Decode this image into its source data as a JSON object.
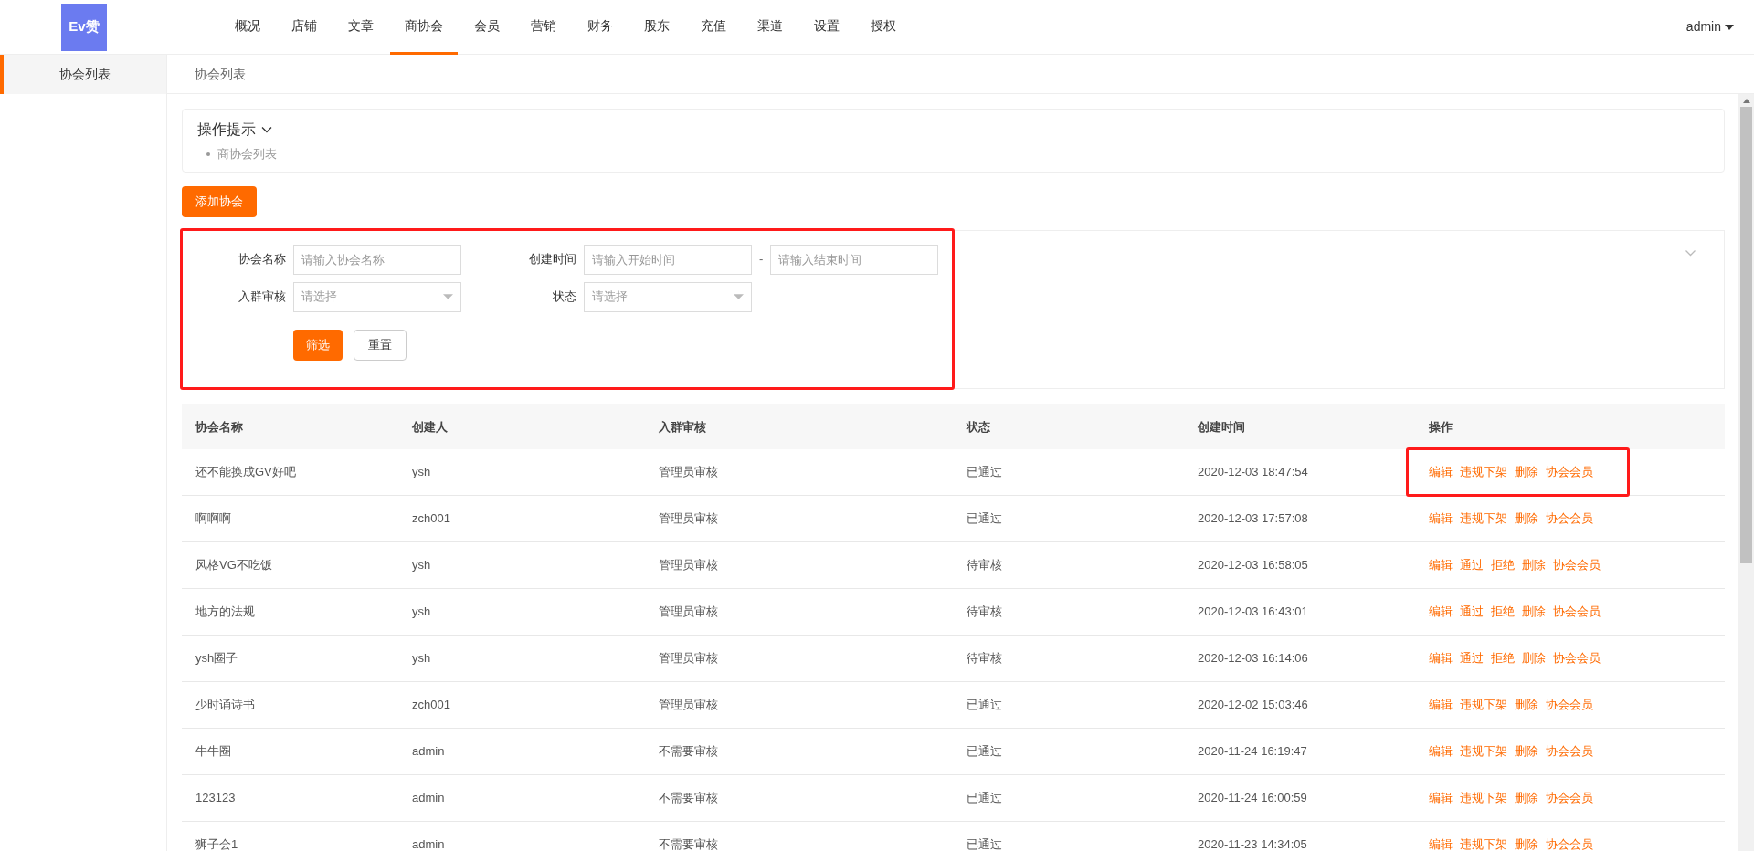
{
  "header": {
    "logo_text": "Ev赞",
    "nav": [
      {
        "label": "概况",
        "selected": false
      },
      {
        "label": "店铺",
        "selected": false
      },
      {
        "label": "文章",
        "selected": false
      },
      {
        "label": "商协会",
        "selected": true
      },
      {
        "label": "会员",
        "selected": false
      },
      {
        "label": "营销",
        "selected": false
      },
      {
        "label": "财务",
        "selected": false
      },
      {
        "label": "股东",
        "selected": false
      },
      {
        "label": "充值",
        "selected": false
      },
      {
        "label": "渠道",
        "selected": false
      },
      {
        "label": "设置",
        "selected": false
      },
      {
        "label": "授权",
        "selected": false
      }
    ],
    "user": "admin"
  },
  "sidebar": {
    "items": [
      {
        "label": "协会列表",
        "selected": true
      }
    ]
  },
  "breadcrumb": "协会列表",
  "tips": {
    "title": "操作提示",
    "items": [
      "商协会列表"
    ]
  },
  "add_button": "添加协会",
  "filter": {
    "highlighted": true,
    "fields": [
      {
        "kind": "text",
        "label": "协会名称",
        "placeholder": "请输入协会名称"
      },
      {
        "kind": "range",
        "label": "创建时间",
        "placeholder": "请输入开始时间",
        "separator": "-",
        "placeholder_end": "请输入结束时间"
      },
      {
        "kind": "select",
        "label": "入群审核",
        "placeholder": "请选择"
      },
      {
        "kind": "select",
        "label": "状态",
        "placeholder": "请选择"
      }
    ],
    "submit": "筛选",
    "reset": "重置"
  },
  "table": {
    "columns": [
      "协会名称",
      "创建人",
      "入群审核",
      "状态",
      "创建时间",
      "操作"
    ],
    "rows": [
      {
        "name": "还不能换成GV好吧",
        "creator": "ysh",
        "review": "管理员审核",
        "status": "已通过",
        "created": "2020-12-03 18:47:54",
        "actions": [
          "编辑",
          "违规下架",
          "删除",
          "协会会员"
        ],
        "actions_highlighted": true
      },
      {
        "name": "啊啊啊",
        "creator": "zch001",
        "review": "管理员审核",
        "status": "已通过",
        "created": "2020-12-03 17:57:08",
        "actions": [
          "编辑",
          "违规下架",
          "删除",
          "协会会员"
        ],
        "actions_highlighted": false
      },
      {
        "name": "风格VG不吃饭",
        "creator": "ysh",
        "review": "管理员审核",
        "status": "待审核",
        "created": "2020-12-03 16:58:05",
        "actions": [
          "编辑",
          "通过",
          "拒绝",
          "删除",
          "协会会员"
        ],
        "actions_highlighted": false
      },
      {
        "name": "地方的法规",
        "creator": "ysh",
        "review": "管理员审核",
        "status": "待审核",
        "created": "2020-12-03 16:43:01",
        "actions": [
          "编辑",
          "通过",
          "拒绝",
          "删除",
          "协会会员"
        ],
        "actions_highlighted": false
      },
      {
        "name": "ysh圈子",
        "creator": "ysh",
        "review": "管理员审核",
        "status": "待审核",
        "created": "2020-12-03 16:14:06",
        "actions": [
          "编辑",
          "通过",
          "拒绝",
          "删除",
          "协会会员"
        ],
        "actions_highlighted": false
      },
      {
        "name": "少时诵诗书",
        "creator": "zch001",
        "review": "管理员审核",
        "status": "已通过",
        "created": "2020-12-02 15:03:46",
        "actions": [
          "编辑",
          "违规下架",
          "删除",
          "协会会员"
        ],
        "actions_highlighted": false
      },
      {
        "name": "牛牛圈",
        "creator": "admin",
        "review": "不需要审核",
        "status": "已通过",
        "created": "2020-11-24 16:19:47",
        "actions": [
          "编辑",
          "违规下架",
          "删除",
          "协会会员"
        ],
        "actions_highlighted": false
      },
      {
        "name": "123123",
        "creator": "admin",
        "review": "不需要审核",
        "status": "已通过",
        "created": "2020-11-24 16:00:59",
        "actions": [
          "编辑",
          "违规下架",
          "删除",
          "协会会员"
        ],
        "actions_highlighted": false
      },
      {
        "name": "狮子会1",
        "creator": "admin",
        "review": "不需要审核",
        "status": "已通过",
        "created": "2020-11-23 14:34:05",
        "actions": [
          "编辑",
          "违规下架",
          "删除",
          "协会会员"
        ],
        "actions_highlighted": false
      }
    ]
  }
}
